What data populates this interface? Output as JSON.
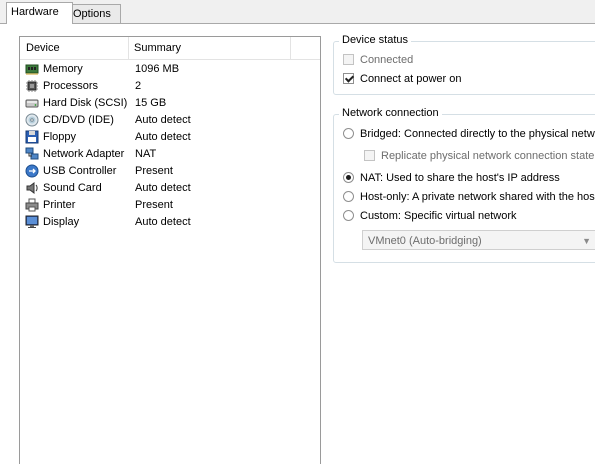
{
  "tabs": [
    {
      "label": "Hardware",
      "active": true
    },
    {
      "label": "Options",
      "active": false
    }
  ],
  "device_list": {
    "columns": {
      "device": "Device",
      "summary": "Summary"
    },
    "rows": [
      {
        "icon": "memory-icon",
        "device": "Memory",
        "summary": "1096 MB"
      },
      {
        "icon": "processor-icon",
        "device": "Processors",
        "summary": "2"
      },
      {
        "icon": "hard-disk-icon",
        "device": "Hard Disk (SCSI)",
        "summary": "15 GB"
      },
      {
        "icon": "cd-dvd-icon",
        "device": "CD/DVD (IDE)",
        "summary": "Auto detect"
      },
      {
        "icon": "floppy-icon",
        "device": "Floppy",
        "summary": "Auto detect"
      },
      {
        "icon": "network-adapter-icon",
        "device": "Network Adapter",
        "summary": "NAT"
      },
      {
        "icon": "usb-icon",
        "device": "USB Controller",
        "summary": "Present"
      },
      {
        "icon": "sound-card-icon",
        "device": "Sound Card",
        "summary": "Auto detect"
      },
      {
        "icon": "printer-icon",
        "device": "Printer",
        "summary": "Present"
      },
      {
        "icon": "display-icon",
        "device": "Display",
        "summary": "Auto detect"
      }
    ]
  },
  "device_status": {
    "title": "Device status",
    "connected": {
      "label": "Connected",
      "checked": false,
      "enabled": false
    },
    "connect_at_power_on": {
      "label": "Connect at power on",
      "checked": true,
      "enabled": true
    }
  },
  "network_connection": {
    "title": "Network connection",
    "bridged": {
      "label": "Bridged: Connected directly to the physical netwo",
      "selected": false
    },
    "replicate": {
      "label": "Replicate physical network connection state",
      "checked": false,
      "enabled": false
    },
    "nat": {
      "label": "NAT: Used to share the host's IP address",
      "selected": true
    },
    "host_only": {
      "label": "Host-only: A private network shared with the hos",
      "selected": false
    },
    "custom": {
      "label": "Custom: Specific virtual network",
      "selected": false
    },
    "custom_network": {
      "value": "VMnet0 (Auto-bridging)",
      "enabled": false
    }
  },
  "colors": {
    "border": "#9a9a9a",
    "group_border": "#d5dfe5",
    "disabled_text": "#6d6d6d"
  }
}
